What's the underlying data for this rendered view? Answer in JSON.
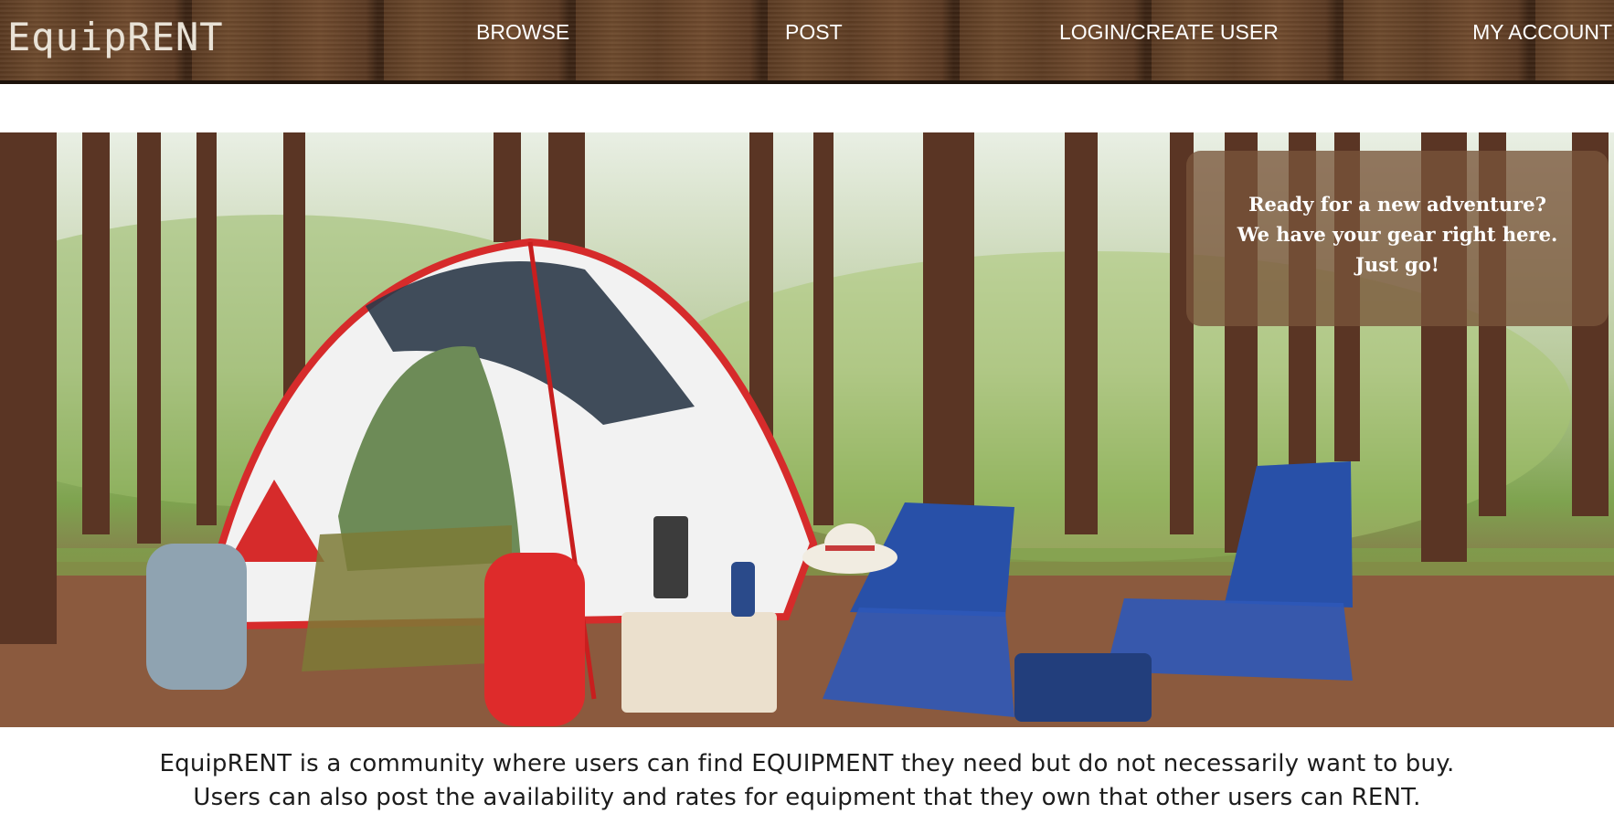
{
  "header": {
    "logo": "EquipRENT",
    "nav": {
      "browse": "BROWSE",
      "post": "POST",
      "login": "LOGIN/CREATE USER",
      "account": "MY ACCOUNT"
    }
  },
  "hero": {
    "overlay": {
      "line1": "Ready for a new adventure?",
      "line2": "We have your gear right here.",
      "line3": "Just go!"
    }
  },
  "description": {
    "line1": "EquipRENT is a community where users can find EQUIPMENT they need but do not necessarily want to buy.",
    "line2": "Users can also post the availability and rates for equipment that they own that other users can RENT."
  },
  "colors": {
    "header_wood": "#5f3e25",
    "overlay_box": "#78543a",
    "text_dark": "#1c1c1c"
  }
}
